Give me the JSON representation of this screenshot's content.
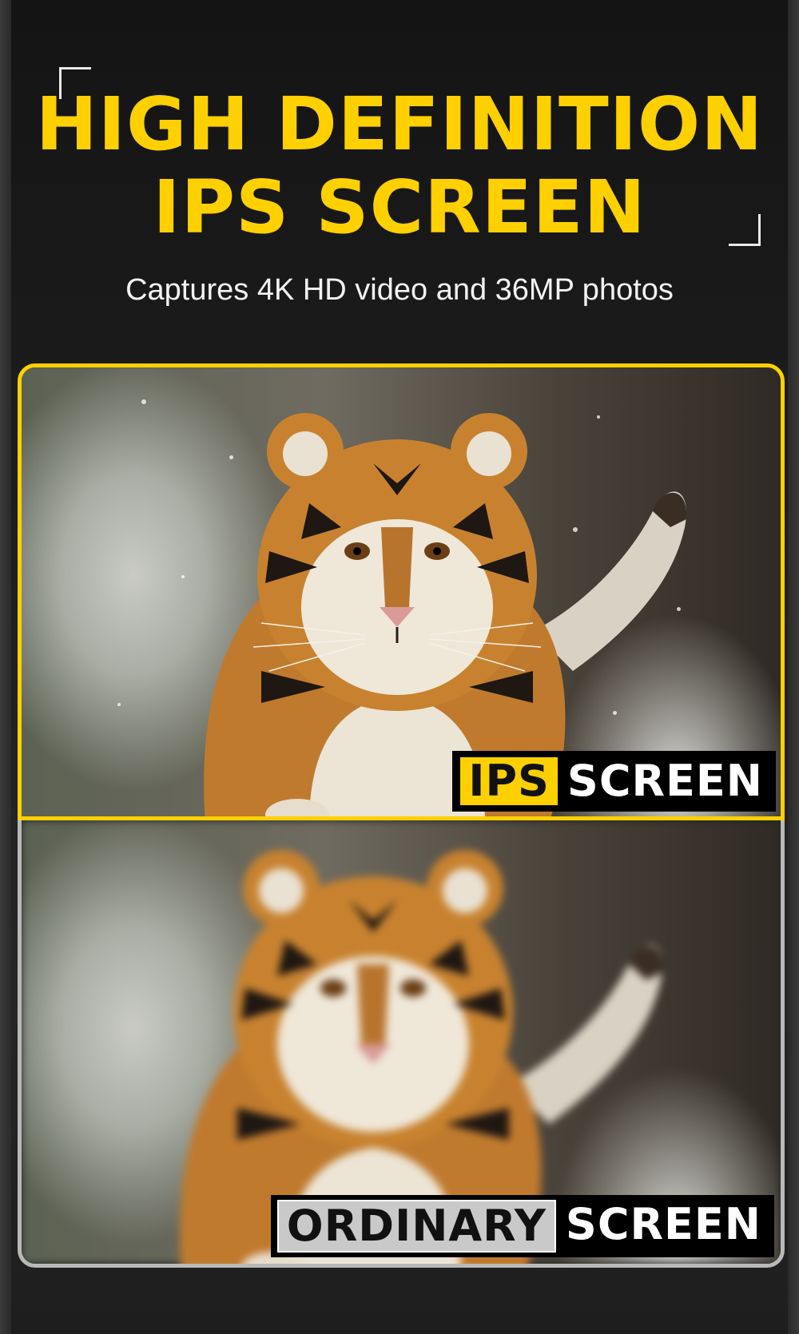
{
  "header": {
    "title_line1": "HIGH DEFINITION",
    "title_line2": "IPS SCREEN",
    "subtitle": "Captures 4K HD video and 36MP photos"
  },
  "comparison": {
    "top_label_highlight": "IPS",
    "top_label_rest": "SCREEN",
    "bottom_label_highlight": "ORDINARY",
    "bottom_label_rest": "SCREEN"
  },
  "colors": {
    "accent": "#ffd000",
    "background": "#1c1c1c",
    "ordinary_frame": "#b9b9b9"
  }
}
